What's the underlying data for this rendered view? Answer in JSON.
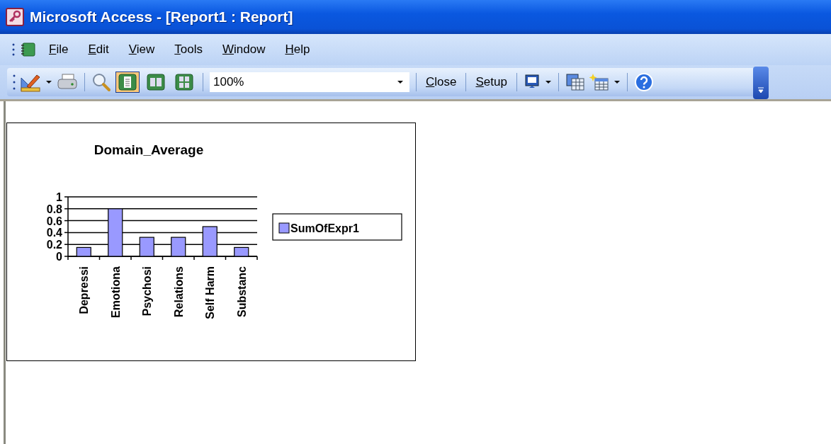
{
  "window": {
    "title": "Microsoft Access - [Report1 : Report]"
  },
  "menu": [
    "File",
    "Edit",
    "View",
    "Tools",
    "Window",
    "Help"
  ],
  "toolbar": {
    "page_views": [
      {
        "selected": true
      },
      {
        "selected": false
      },
      {
        "selected": false
      }
    ],
    "zoom": {
      "value": "100%"
    },
    "buttons": [
      "Close",
      "Setup"
    ]
  },
  "report": {
    "chart_data": {
      "type": "bar",
      "title": "Domain_Average",
      "categories": [
        "Depressi",
        "Emotiona",
        "Psychosi",
        "Relations",
        "Self Harm",
        "Substanc"
      ],
      "series": [
        {
          "name": "SumOfExpr1",
          "color": "#9999ff",
          "values": [
            0.15,
            0.8,
            0.32,
            0.32,
            0.5,
            0.15
          ]
        }
      ],
      "ylim": [
        0,
        1
      ],
      "grid": true,
      "yticks": [
        0,
        0.2,
        0.4,
        0.6,
        0.8,
        1
      ]
    }
  }
}
